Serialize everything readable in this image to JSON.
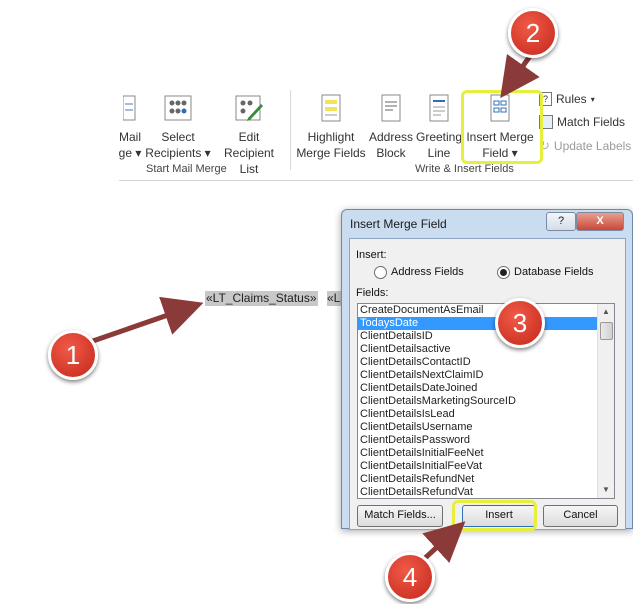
{
  "ribbon": {
    "mail_label": "Mail",
    "mail_sub": "ge",
    "select_recipients_line1": "Select",
    "select_recipients_line2": "Recipients",
    "edit_list_line1": "Edit",
    "edit_list_line2": "Recipient List",
    "group_start": "Start Mail Merge",
    "highlight_line1": "Highlight",
    "highlight_line2": "Merge Fields",
    "address_line1": "Address",
    "address_line2": "Block",
    "greeting_line1": "Greeting",
    "greeting_line2": "Line",
    "insert_merge_line1": "Insert Merge",
    "insert_merge_line2": "Field",
    "rules": "Rules",
    "match_fields": "Match Fields",
    "update_labels": "Update Labels",
    "group_write": "Write & Insert Fields"
  },
  "document": {
    "field1": "«LT_Claims_Status»",
    "field2": "«L"
  },
  "dialog": {
    "title": "Insert Merge Field",
    "help": "?",
    "close": "X",
    "insert_label": "Insert:",
    "address_fields": "Address Fields",
    "database_fields": "Database Fields",
    "fields_label": "Fields:",
    "fields": [
      "CreateDocumentAsEmail",
      "TodaysDate",
      "ClientDetailsID",
      "ClientDetailsactive",
      "ClientDetailsContactID",
      "ClientDetailsNextClaimID",
      "ClientDetailsDateJoined",
      "ClientDetailsMarketingSourceID",
      "ClientDetailsIsLead",
      "ClientDetailsUsername",
      "ClientDetailsPassword",
      "ClientDetailsInitialFeeNet",
      "ClientDetailsInitialFeeVat",
      "ClientDetailsRefundNet",
      "ClientDetailsRefundVat"
    ],
    "selected_index": 1,
    "match_fields_btn": "Match Fields...",
    "insert_btn": "Insert",
    "cancel_btn": "Cancel"
  },
  "callouts": [
    "1",
    "2",
    "3",
    "4"
  ],
  "colors": {
    "callout": "#d2382a",
    "highlight": "#e6ef3c",
    "arrow": "#8b3a3a",
    "selection": "#3399ff"
  }
}
